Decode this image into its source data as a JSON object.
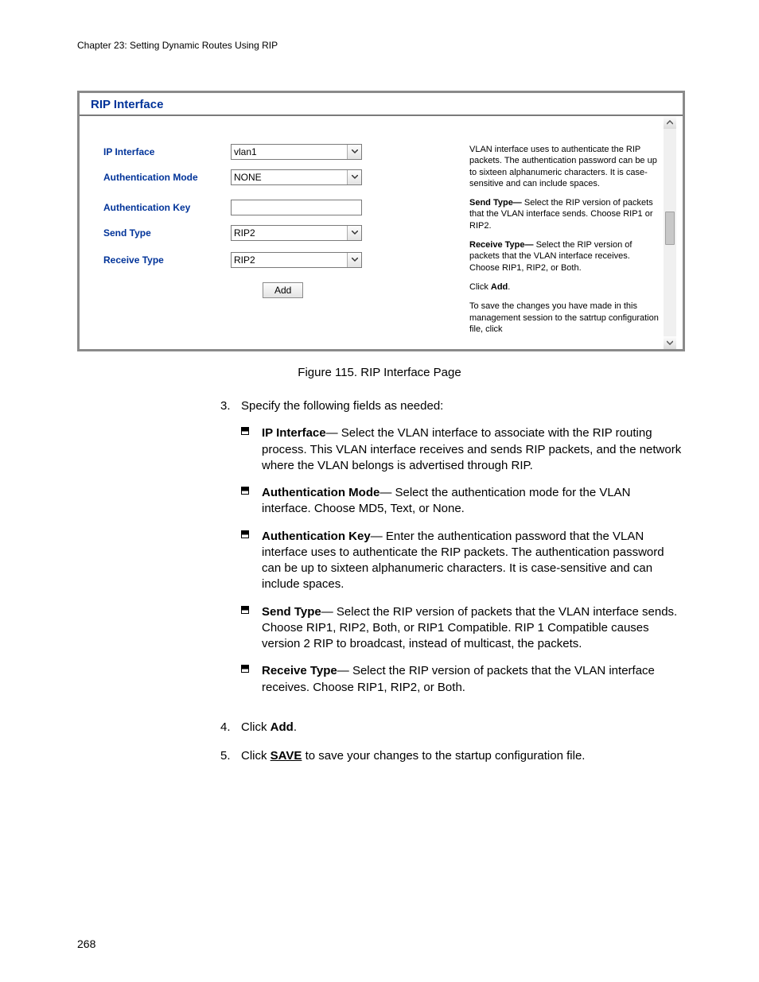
{
  "header": "Chapter 23: Setting Dynamic Routes Using RIP",
  "page_number": "268",
  "screenshot": {
    "title": "RIP Interface",
    "fields": {
      "ip_interface": {
        "label": "IP Interface",
        "value": "vlan1"
      },
      "auth_mode": {
        "label": "Authentication Mode",
        "value": "NONE"
      },
      "auth_key": {
        "label": "Authentication Key",
        "value": ""
      },
      "send_type": {
        "label": "Send Type",
        "value": "RIP2"
      },
      "receive_type": {
        "label": "Receive Type",
        "value": "RIP2"
      }
    },
    "add_button": "Add",
    "help": {
      "p1": "VLAN interface uses to authenticate the RIP packets. The authentication password can be up to sixteen alphanumeric characters. It is case-sensitive and can include spaces.",
      "p2a": "Send Type—",
      "p2b": " Select the RIP version of packets that the VLAN interface sends. Choose RIP1 or RIP2.",
      "p3a": "Receive Type—",
      "p3b": " Select the RIP version of packets that the VLAN interface receives. Choose RIP1, RIP2, or Both.",
      "p4a": "Click ",
      "p4b": "Add",
      "p4c": ".",
      "p5": "To save the changes you have made in this management session to the satrtup configuration file, click"
    }
  },
  "caption": "Figure 115. RIP Interface Page",
  "steps": {
    "s3": {
      "num": "3.",
      "intro": "Specify the following fields as needed:",
      "items": {
        "a": {
          "term": "IP Interface",
          "rest": "— Select the VLAN interface to associate with the RIP routing process. This VLAN interface receives and sends RIP packets, and the network where the VLAN belongs is advertised through RIP."
        },
        "b": {
          "term": "Authentication Mode",
          "rest": "— Select the authentication mode for the VLAN interface. Choose MD5, Text, or None."
        },
        "c": {
          "term": "Authentication Key",
          "rest": "— Enter the authentication password that the VLAN interface uses to authenticate the RIP packets. The authentication password can be up to sixteen alphanumeric characters. It is case-sensitive and can include spaces."
        },
        "d": {
          "term": "Send Type",
          "rest": "— Select the RIP version of packets that the VLAN interface sends. Choose RIP1, RIP2, Both, or RIP1 Compatible. RIP 1 Compatible causes version 2 RIP to broadcast, instead of multicast, the packets."
        },
        "e": {
          "term": "Receive Type",
          "rest": "— Select the RIP version of packets that the VLAN interface receives. Choose RIP1, RIP2, or Both."
        }
      }
    },
    "s4": {
      "num": "4.",
      "pre": "Click ",
      "bold": "Add",
      "post": "."
    },
    "s5": {
      "num": "5.",
      "pre": "Click ",
      "link": "SAVE",
      "post": " to save your changes to the startup configuration file."
    }
  }
}
